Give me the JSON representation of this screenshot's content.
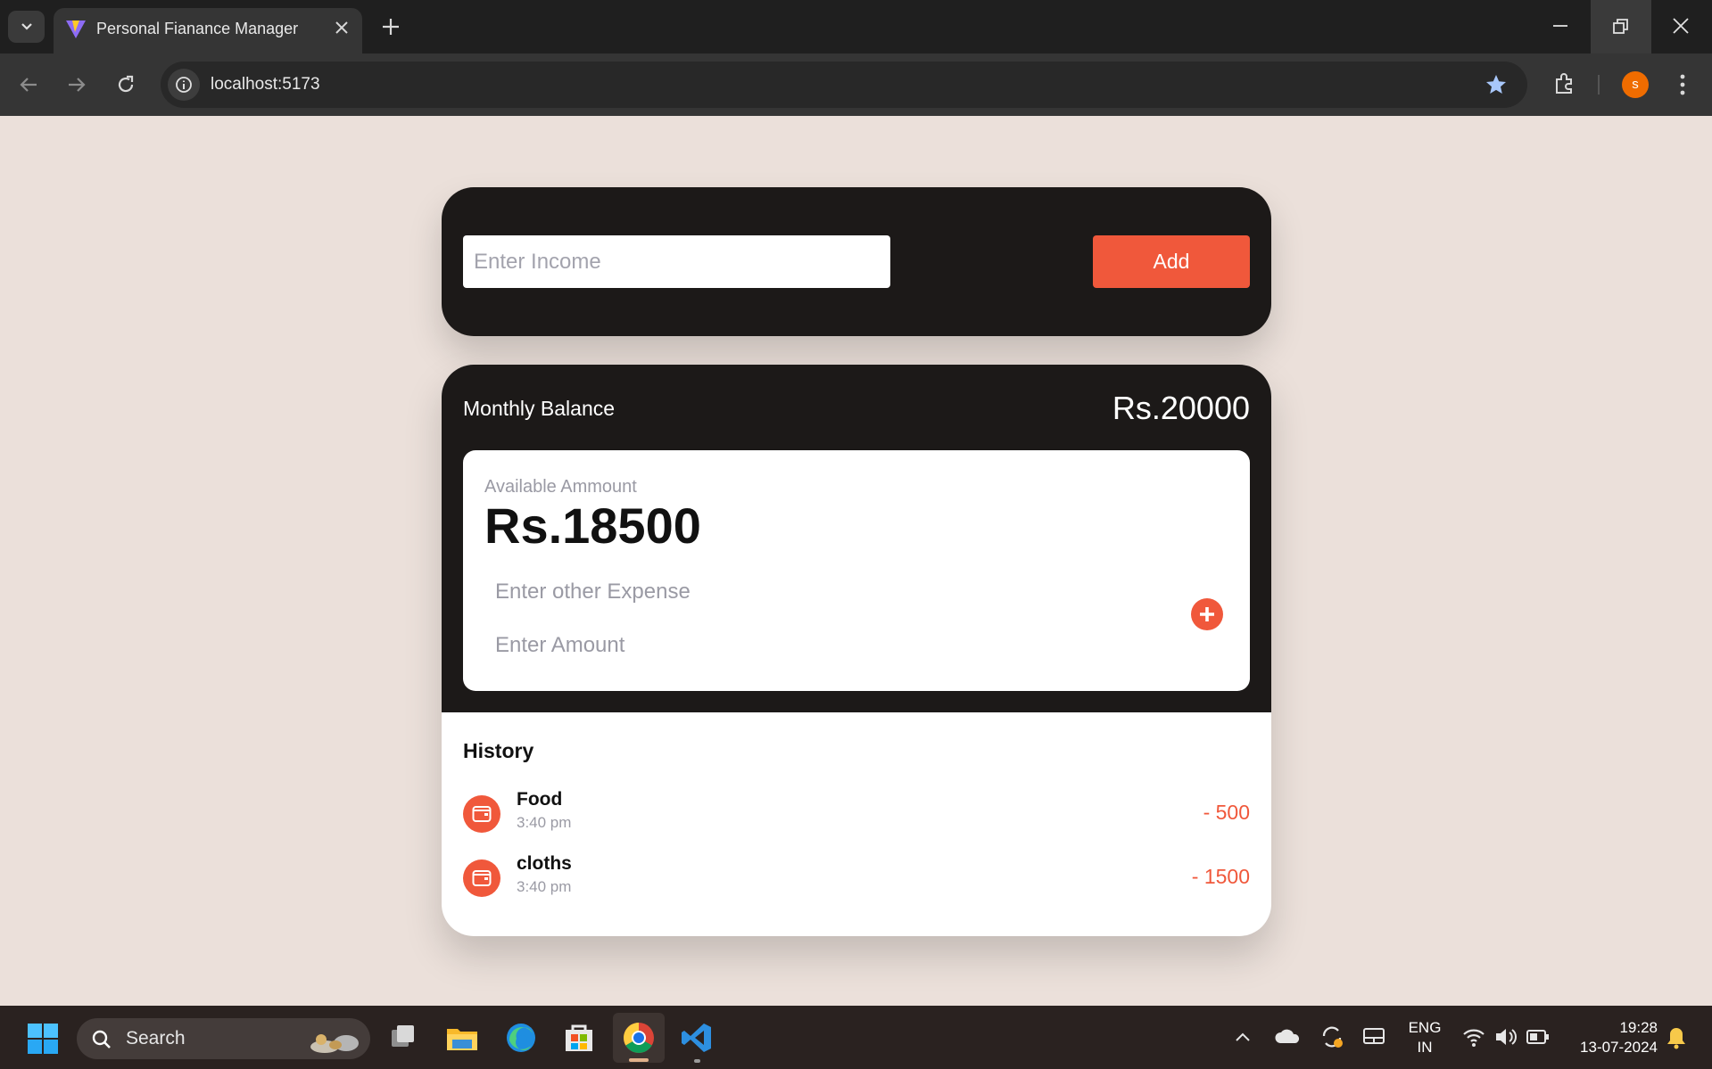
{
  "browser": {
    "tab_title": "Personal Fianance Manager",
    "url": "localhost:5173",
    "profile_initial": "s"
  },
  "income": {
    "placeholder": "Enter Income",
    "add_label": "Add"
  },
  "balance": {
    "label": "Monthly Balance",
    "value": "Rs.20000"
  },
  "available": {
    "label": "Available Ammount",
    "value": "Rs.18500",
    "expense_placeholder": "Enter other Expense",
    "amount_placeholder": "Enter Amount"
  },
  "history": {
    "title": "History",
    "items": [
      {
        "name": "Food",
        "time": "3:40 pm",
        "amount": "- 500"
      },
      {
        "name": "cloths",
        "time": "3:40 pm",
        "amount": "- 1500"
      }
    ]
  },
  "taskbar": {
    "search_label": "Search",
    "lang_line1": "ENG",
    "lang_line2": "IN",
    "time": "19:28",
    "date": "13-07-2024"
  },
  "colors": {
    "accent": "#f0583b",
    "card_dark": "#1c1918",
    "page_bg": "#ebe0da"
  }
}
